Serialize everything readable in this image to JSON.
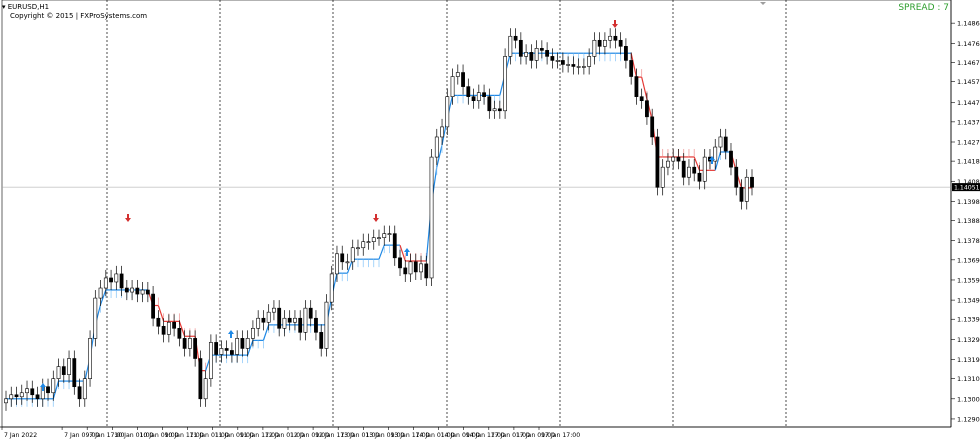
{
  "header": {
    "symbol_timeframe": "EURUSD,H1",
    "copyright": "Copyright © 2015 | FXProSystems.com",
    "spread_label": "SPREAD : 7"
  },
  "colors": {
    "candle_bull_fill": "#ffffff",
    "candle_bear_fill": "#000000",
    "candle_outline": "#000000",
    "trend_up_line": "#1e88e5",
    "trend_down_line": "#e53935",
    "trend_up_histogram": "#90caf9",
    "trend_down_histogram": "#ef9a9a",
    "arrow_buy": "#1e88e5",
    "arrow_sell": "#d32f2f",
    "separator": "#000000",
    "price_marker_bg": "#000000",
    "price_marker_text": "#ffffff",
    "spread_text": "#2e9e2e"
  },
  "chart_data": {
    "type": "candlestick",
    "symbol": "EURUSD",
    "timeframe": "H1",
    "ylim": [
      1.1286,
      1.1498
    ],
    "y_ticks": [
      "1.14865",
      "1.14765",
      "1.14670",
      "1.14575",
      "1.14470",
      "1.14375",
      "1.14275",
      "1.14180",
      "1.14080",
      "1.13980",
      "1.13885",
      "1.13785",
      "1.13690",
      "1.13590",
      "1.13490",
      "1.13395",
      "1.13295",
      "1.13195",
      "1.13100",
      "1.13000",
      "1.12900"
    ],
    "x_ticks": [
      "7 Jan 2022",
      "7 Jan 09:00",
      "7 Jan 17:00",
      "10 Jan 01:00",
      "10 Jan 09:00",
      "10 Jan 17:00",
      "11 Jan 01:00",
      "11 Jan 09:00",
      "11 Jan 17:00",
      "12 Jan 01:00",
      "12 Jan 09:00",
      "12 Jan 17:00",
      "13 Jan 01:00",
      "13 Jan 09:00",
      "13 Jan 17:00",
      "14 Jan 01:00",
      "14 Jan 09:00",
      "14 Jan 17:00",
      "17 Jan 01:00",
      "17 Jan 09:00",
      "17 Jan 17:00"
    ],
    "current_price": "1.14051",
    "grid": "vertical dotted day separators",
    "close": [
      1.13,
      1.1302,
      1.1301,
      1.1303,
      1.1305,
      1.1302,
      1.13,
      1.1306,
      1.1303,
      1.131,
      1.1316,
      1.1312,
      1.132,
      1.1306,
      1.13,
      1.131,
      1.133,
      1.135,
      1.1355,
      1.136,
      1.1358,
      1.1362,
      1.1355,
      1.1353,
      1.1355,
      1.1352,
      1.1354,
      1.1352,
      1.134,
      1.1336,
      1.1332,
      1.1338,
      1.1335,
      1.133,
      1.1325,
      1.133,
      1.132,
      1.13,
      1.131,
      1.1328,
      1.1322,
      1.1325,
      1.1324,
      1.1322,
      1.133,
      1.1325,
      1.133,
      1.1335,
      1.134,
      1.1338,
      1.1343,
      1.1345,
      1.1335,
      1.134,
      1.1338,
      1.134,
      1.1333,
      1.1345,
      1.134,
      1.1333,
      1.1325,
      1.1348,
      1.1362,
      1.1372,
      1.1368,
      1.1368,
      1.1375,
      1.1375,
      1.1378,
      1.1378,
      1.138,
      1.138,
      1.1382,
      1.1382,
      1.137,
      1.1365,
      1.1362,
      1.1368,
      1.1363,
      1.1367,
      1.136,
      1.142,
      1.143,
      1.1435,
      1.145,
      1.146,
      1.1462,
      1.1455,
      1.145,
      1.1448,
      1.1452,
      1.145,
      1.1443,
      1.1444,
      1.1443,
      1.147,
      1.148,
      1.1478,
      1.147,
      1.1472,
      1.1468,
      1.1474,
      1.1473,
      1.147,
      1.1468,
      1.1468,
      1.1466,
      1.1466,
      1.1465,
      1.1465,
      1.1465,
      1.147,
      1.1478,
      1.1475,
      1.1478,
      1.148,
      1.1478,
      1.1475,
      1.1468,
      1.146,
      1.145,
      1.1448,
      1.144,
      1.143,
      1.1405,
      1.1415,
      1.1418,
      1.142,
      1.1418,
      1.141,
      1.1415,
      1.1412,
      1.1408,
      1.142,
      1.1418,
      1.1425,
      1.143,
      1.1423,
      1.1415,
      1.1405,
      1.1398,
      1.141,
      1.1405
    ]
  }
}
